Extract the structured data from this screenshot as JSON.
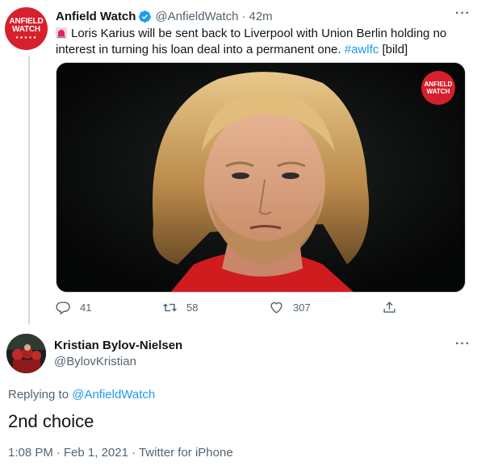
{
  "tweet": {
    "author_name": "Anfield Watch",
    "author_handle": "@AnfieldWatch",
    "separator": "·",
    "time_ago": "42m",
    "avatar_text_line1": "ANFIELD",
    "avatar_text_line2": "WATCH",
    "body_main": "Loris Karius will be sent back to Liverpool with Union Berlin holding no interest in turning his loan deal into a permanent one.",
    "hashtag": "#awlfc",
    "body_suffix": "[bild]",
    "media_badge_line1": "ANFIELD",
    "media_badge_line2": "WATCH",
    "replies_count": "41",
    "retweets_count": "58",
    "likes_count": "307",
    "icons": [
      "verified-icon",
      "siren-icon",
      "more-icon",
      "reply-icon",
      "retweet-icon",
      "like-icon",
      "share-icon"
    ]
  },
  "reply": {
    "author_name": "Kristian Bylov-Nielsen",
    "author_handle": "@BylovKristian",
    "replying_to_label": "Replying to",
    "replying_to_handle": "@AnfieldWatch",
    "text": "2nd choice",
    "time": "1:08 PM",
    "separator": "·",
    "date": "Feb 1, 2021",
    "source": "Twitter for iPhone"
  },
  "colors": {
    "accent": "#1d9bf0",
    "brand_red": "#d6202b",
    "secondary_text": "#536471",
    "primary_text": "#0f1419"
  }
}
